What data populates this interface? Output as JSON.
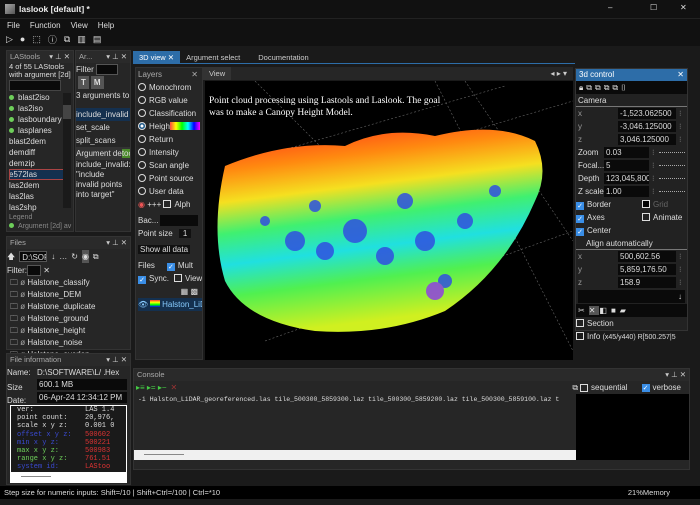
{
  "window": {
    "title": "laslook [default] *",
    "min": "–",
    "max": "☐",
    "close": "✕"
  },
  "menu": [
    "File",
    "Function",
    "View",
    "Help"
  ],
  "toolbar_icons": [
    "run-icon",
    "record-icon",
    "select-icon",
    "info-icon",
    "cube-icon",
    "book-icon",
    "doc-icon"
  ],
  "lastools": {
    "title": "LAStools",
    "summary": "4 of 55 LAStools with argument [2d]",
    "items": [
      {
        "label": "blast2iso",
        "dot": true
      },
      {
        "label": "las2iso",
        "dot": true
      },
      {
        "label": "lasboundary",
        "dot": true
      },
      {
        "label": "lasplanes",
        "dot": true
      },
      {
        "label": "blast2dem"
      },
      {
        "label": "demdiff"
      },
      {
        "label": "demzip"
      },
      {
        "label": "e572las",
        "selected": true
      },
      {
        "label": "las2dem"
      },
      {
        "label": "las2las"
      },
      {
        "label": "las2shp"
      }
    ],
    "legend": "Legend",
    "legend_item": "Argument [2d] av"
  },
  "arguments": {
    "title": "Ar...",
    "filter": "Filter",
    "t": "T",
    "m": "M",
    "count": "3 arguments to",
    "items": [
      "include_invalid",
      "set_scale",
      "split_scans"
    ],
    "doc_title": "Argument de",
    "doc_tag": "tool",
    "doc_text": "include_invalid: \"include invalid points into target\""
  },
  "tabs": [
    "3D view",
    "Argument select",
    "Documentation"
  ],
  "layers": {
    "title": "Layers",
    "options": [
      "Monochrom",
      "RGB value",
      "Classification",
      "Heigh",
      "Return",
      "Intensity",
      "Scan angle",
      "Point source",
      "User data"
    ],
    "selected": 3,
    "plus": "+++",
    "alpha": "Alph",
    "bac": "Bac...",
    "point_size_label": "Point size",
    "point_size": "1",
    "show_all": "Show all data",
    "files_label": "Files",
    "mult": "Mult",
    "sync": "Sync.",
    "view": "View",
    "file_item": "Halston_LiD"
  },
  "view": {
    "tab": "View",
    "caption": "Point cloud processing using Lastools and Laslook. The goal was to make a Canopy Height Model."
  },
  "control": {
    "title": "3d control",
    "camera": "Camera",
    "cam": [
      {
        "k": "x",
        "v": "-1,523.062500"
      },
      {
        "k": "y",
        "v": "-3,046.125000"
      },
      {
        "k": "z",
        "v": "3,046.125000"
      }
    ],
    "params": [
      {
        "k": "Zoom",
        "v": "0.03"
      },
      {
        "k": "Focal...",
        "v": "5"
      },
      {
        "k": "Depth",
        "v": "123,045,800."
      },
      {
        "k": "Z scale",
        "v": "1.00"
      }
    ],
    "border": "Border",
    "grid": "Grid",
    "axes": "Axes",
    "animate": "Animate",
    "center": "Center",
    "align": "Align automatically",
    "pos": [
      {
        "k": "x",
        "v": "500,602.56"
      },
      {
        "k": "y",
        "v": "5,859,176.50"
      },
      {
        "k": "z",
        "v": "158.9"
      }
    ],
    "section": "Section",
    "info": "Info",
    "info_text": "(x45/y440)  R[500.257|5"
  },
  "files": {
    "title": "Files",
    "path": "D:\\SOFTW",
    "filter": "Filter:",
    "items": [
      "Halstone_classify",
      "Halstone_DEM",
      "Halstone_duplicate",
      "Halstone_ground",
      "Halstone_height",
      "Halstone_noise",
      "Halstone_overlap"
    ]
  },
  "fileinfo": {
    "title": "File information",
    "name_label": "Name:",
    "name": "D:\\SOFTWARE\\L/ .",
    "hex": "Hex",
    "size_label": "Size",
    "size": "600.1 MB",
    "date_label": "Date:",
    "date": "06-Apr-24 12:34:12 PM",
    "rows": [
      {
        "k": "ver:",
        "v": "LAS 1.4",
        "c": "#ddd"
      },
      {
        "k": "point count:",
        "v": "20,976,",
        "c": "#ddd"
      },
      {
        "k": "scale x y z:",
        "v": "0.001 0",
        "c": "#ddd"
      },
      {
        "k": "offset x y z:",
        "v": "500602",
        "c": "#3a4ad0"
      },
      {
        "k": "min x y z:",
        "v": "500221",
        "c": "#3a4ad0"
      },
      {
        "k": "max x y z:",
        "v": "500983",
        "c": "#6ecf5a"
      },
      {
        "k": "range x y z:",
        "v": "761.51",
        "c": "#6ecf5a"
      },
      {
        "k": "system id:",
        "v": "LAStoo",
        "c": "#3a4ad0"
      }
    ]
  },
  "console": {
    "title": "Console",
    "sequential": "sequential",
    "verbose": "verbose",
    "command": "-i Halston_LiDAR_georeferenced.las tile_500300_5859300.laz tile_500300_5859200.laz tile_500300_5859100.laz t"
  },
  "status": {
    "left": "Step size for numeric inputs: Shift=/10 | Shift+Ctrl=/100 | Ctrl=*10",
    "right": "21%Memory"
  }
}
